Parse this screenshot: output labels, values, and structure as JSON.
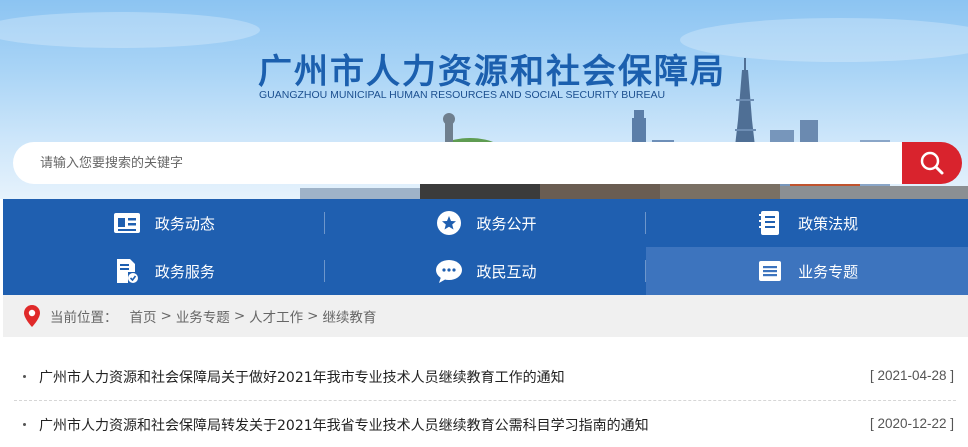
{
  "site": {
    "title": "广州市人力资源和社会保障局",
    "subtitle": "GUANGZHOU MUNICIPAL HUMAN RESOURCES AND SOCIAL SECURITY BUREAU"
  },
  "search": {
    "placeholder": "请输入您要搜索的关键字",
    "button_icon": "search-icon"
  },
  "nav": {
    "rows": [
      [
        {
          "label": "政务动态",
          "icon": "news-icon"
        },
        {
          "label": "政务公开",
          "icon": "star-icon"
        },
        {
          "label": "政策法规",
          "icon": "document-icon"
        }
      ],
      [
        {
          "label": "政务服务",
          "icon": "service-doc-icon"
        },
        {
          "label": "政民互动",
          "icon": "chat-icon"
        },
        {
          "label": "业务专题",
          "icon": "list-icon",
          "active": true
        }
      ]
    ]
  },
  "breadcrumb": {
    "prefix": "当前位置：",
    "items": [
      "首页",
      "业务专题",
      "人才工作",
      "继续教育"
    ],
    "separator": ">"
  },
  "articles": [
    {
      "title": "广州市人力资源和社会保障局关于做好2021年我市专业技术人员继续教育工作的通知",
      "date": "[ 2021-04-28 ]"
    },
    {
      "title": "广州市人力资源和社会保障局转发关于2021年我省专业技术人员继续教育公需科目学习指南的通知",
      "date": "[ 2020-12-22 ]"
    }
  ],
  "colors": {
    "brand_blue": "#1f5fb0",
    "active_nav": "#3d74be",
    "search_red": "#d9232d",
    "pin_red": "#e02a2a"
  }
}
